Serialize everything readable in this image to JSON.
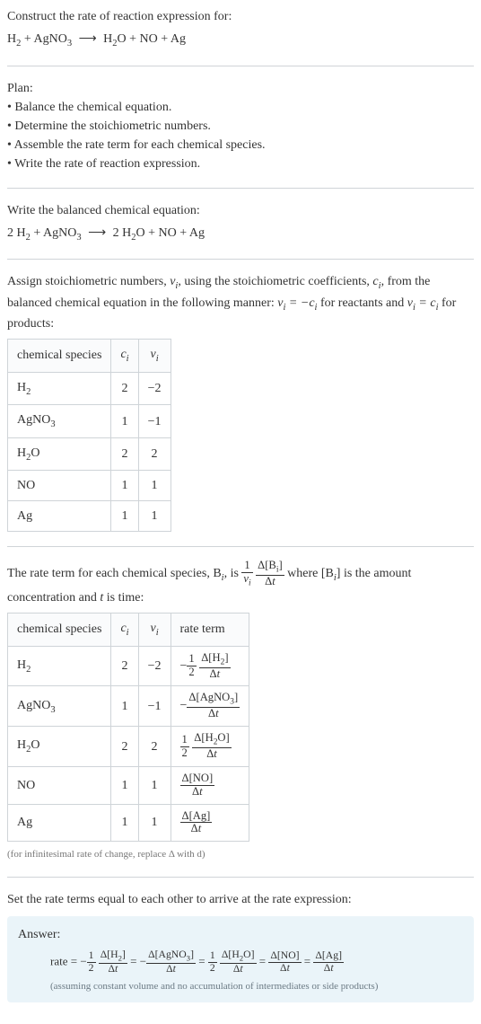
{
  "intro": {
    "prompt": "Construct the rate of reaction expression for:",
    "equation_lhs": "H",
    "equation_plus": " + AgNO",
    "equation_arrow": "⟶",
    "equation_rhs": "H",
    "equation_suffix": "O + NO + Ag"
  },
  "plan": {
    "title": "Plan:",
    "items": [
      "Balance the chemical equation.",
      "Determine the stoichiometric numbers.",
      "Assemble the rate term for each chemical species.",
      "Write the rate of reaction expression."
    ]
  },
  "balanced": {
    "title": "Write the balanced chemical equation:",
    "equation": "2 H₂ + AgNO₃ ⟶ 2 H₂O + NO + Ag"
  },
  "stoich": {
    "intro_pre": "Assign stoichiometric numbers, ",
    "intro_nu": "ν",
    "intro_mid1": ", using the stoichiometric coefficients, ",
    "intro_c": "c",
    "intro_mid2": ", from the balanced chemical equation in the following manner: ",
    "intro_rel1": "νᵢ = −cᵢ",
    "intro_mid3": " for reactants and ",
    "intro_rel2": "νᵢ = cᵢ",
    "intro_mid4": " for products:",
    "headers": [
      "chemical species",
      "cᵢ",
      "νᵢ"
    ],
    "rows": [
      {
        "species": "H₂",
        "c": "2",
        "nu": "−2"
      },
      {
        "species": "AgNO₃",
        "c": "1",
        "nu": "−1"
      },
      {
        "species": "H₂O",
        "c": "2",
        "nu": "2"
      },
      {
        "species": "NO",
        "c": "1",
        "nu": "1"
      },
      {
        "species": "Ag",
        "c": "1",
        "nu": "1"
      }
    ]
  },
  "rateterm": {
    "intro_pre": "The rate term for each chemical species, B",
    "intro_mid1": ", is ",
    "frac1_num": "1",
    "frac1_den": "νᵢ",
    "frac2_num": "Δ[Bᵢ]",
    "frac2_den": "Δt",
    "intro_mid2": " where [B",
    "intro_mid3": "] is the amount concentration and ",
    "intro_t": "t",
    "intro_mid4": " is time:",
    "headers": [
      "chemical species",
      "cᵢ",
      "νᵢ",
      "rate term"
    ],
    "rows": [
      {
        "species": "H₂",
        "c": "2",
        "nu": "−2",
        "half_num": "1",
        "half_den": "2",
        "d_num": "Δ[H₂]",
        "d_den": "Δt",
        "sign": "−"
      },
      {
        "species": "AgNO₃",
        "c": "1",
        "nu": "−1",
        "half_num": "",
        "half_den": "",
        "d_num": "Δ[AgNO₃]",
        "d_den": "Δt",
        "sign": "−"
      },
      {
        "species": "H₂O",
        "c": "2",
        "nu": "2",
        "half_num": "1",
        "half_den": "2",
        "d_num": "Δ[H₂O]",
        "d_den": "Δt",
        "sign": ""
      },
      {
        "species": "NO",
        "c": "1",
        "nu": "1",
        "half_num": "",
        "half_den": "",
        "d_num": "Δ[NO]",
        "d_den": "Δt",
        "sign": ""
      },
      {
        "species": "Ag",
        "c": "1",
        "nu": "1",
        "half_num": "",
        "half_den": "",
        "d_num": "Δ[Ag]",
        "d_den": "Δt",
        "sign": ""
      }
    ],
    "note": "(for infinitesimal rate of change, replace Δ with d)"
  },
  "final": {
    "title": "Set the rate terms equal to each other to arrive at the rate expression:",
    "answer_label": "Answer:",
    "rate_label": "rate = ",
    "eq": " = ",
    "half_num": "1",
    "half_den": "2",
    "terms": [
      {
        "sign": "−",
        "half": true,
        "num": "Δ[H₂]",
        "den": "Δt"
      },
      {
        "sign": "−",
        "half": false,
        "num": "Δ[AgNO₃]",
        "den": "Δt"
      },
      {
        "sign": "",
        "half": true,
        "num": "Δ[H₂O]",
        "den": "Δt"
      },
      {
        "sign": "",
        "half": false,
        "num": "Δ[NO]",
        "den": "Δt"
      },
      {
        "sign": "",
        "half": false,
        "num": "Δ[Ag]",
        "den": "Δt"
      }
    ],
    "note": "(assuming constant volume and no accumulation of intermediates or side products)"
  },
  "chart_data": {
    "type": "table",
    "tables": [
      {
        "title": "Stoichiometric numbers",
        "headers": [
          "chemical species",
          "c_i",
          "nu_i"
        ],
        "rows": [
          [
            "H2",
            2,
            -2
          ],
          [
            "AgNO3",
            1,
            -1
          ],
          [
            "H2O",
            2,
            2
          ],
          [
            "NO",
            1,
            1
          ],
          [
            "Ag",
            1,
            1
          ]
        ]
      },
      {
        "title": "Rate terms",
        "headers": [
          "chemical species",
          "c_i",
          "nu_i",
          "rate term"
        ],
        "rows": [
          [
            "H2",
            2,
            -2,
            "-(1/2) d[H2]/dt"
          ],
          [
            "AgNO3",
            1,
            -1,
            "-d[AgNO3]/dt"
          ],
          [
            "H2O",
            2,
            2,
            "(1/2) d[H2O]/dt"
          ],
          [
            "NO",
            1,
            1,
            "d[NO]/dt"
          ],
          [
            "Ag",
            1,
            1,
            "d[Ag]/dt"
          ]
        ]
      }
    ]
  }
}
